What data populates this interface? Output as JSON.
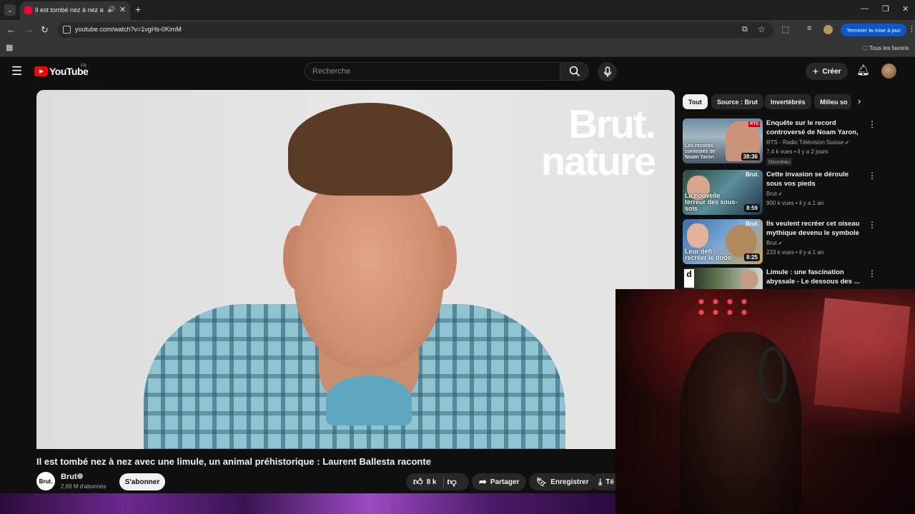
{
  "browser": {
    "tab_title": "Il est tombé nez à nez avec",
    "url": "youtube.com/watch?v=1vgHs-0KimM",
    "update_button": "Terminer la mise à jour",
    "favorites_label": "Tous les favoris"
  },
  "yt": {
    "logo": "YouTube",
    "country": "FR",
    "search_placeholder": "Recherche",
    "create_label": "Créer"
  },
  "video": {
    "title": "Il est tombé nez à nez avec une limule, un animal préhistorique : Laurent Ballesta raconte",
    "overlay_logo_line1": "Brut.",
    "overlay_logo_line2": "nature",
    "channel_avatar": "Brut.",
    "channel": "Brut",
    "subscribers": "2,69 M d'abonnés",
    "subscribe_label": "S'abonner",
    "likes": "8 k",
    "share_label": "Partager",
    "save_label": "Enregistrer",
    "download_label": "Té"
  },
  "chips": [
    "Tout",
    "Source : Brut",
    "Invertébrés",
    "Milieu so"
  ],
  "recommendations": [
    {
      "title": "Enquête sur le record controversé de Noam Yaron, ...",
      "channel": "RTS - Radio Télévision Suisse",
      "meta": "7,4 k vues • il y a 2 jours",
      "badge": "Nouveau",
      "duration": "38:36",
      "thumb_text": "Les records contestés de Noam Yaron"
    },
    {
      "title": "Cette invasion se déroule sous vos pieds",
      "channel": "Brut",
      "meta": "900 k vues • il y a 1 an",
      "duration": "8:59",
      "thumb_text": "La nouvelle terreur des sous-sols"
    },
    {
      "title": "Ils veulent recréer cet oiseau mythique devenu le symbole d...",
      "channel": "Brut",
      "meta": "223 k vues • il y a 1 an",
      "duration": "8:25",
      "thumb_text": "Leur défi : recréer le dodo"
    },
    {
      "title": "Limule : une fascination abyssale - Le dessous des ...",
      "channel": "",
      "meta": ""
    }
  ],
  "colors": {
    "yt_red": "#ff0000",
    "background": "#0f0f0f",
    "update_blue": "#0b57d0"
  }
}
